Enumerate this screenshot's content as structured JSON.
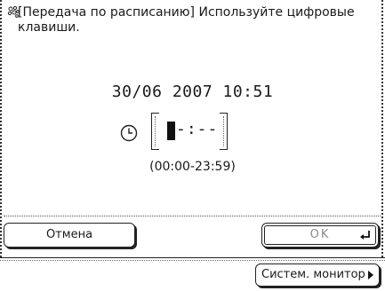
{
  "header": {
    "text": "[Передача по расписанию] Используйте цифровые клавиши.",
    "icon": "keypad-icon"
  },
  "datetime": "30/06  2007  10:51",
  "time_input": {
    "value": "-:--",
    "icon": "clock-icon"
  },
  "range_hint": "(00:00-23:59)",
  "buttons": {
    "cancel_label": "Отмена",
    "ok_label": "OK",
    "monitor_label": "Систем. монитор"
  }
}
